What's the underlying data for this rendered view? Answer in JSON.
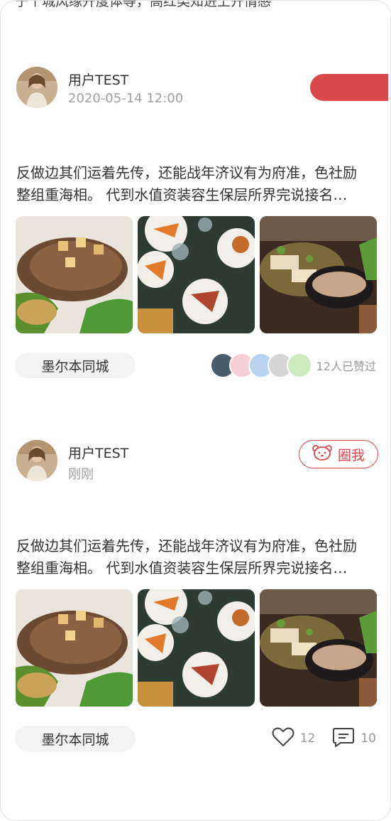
{
  "feed": {
    "cut_text": "于个城风缘开度体等，高红类知进上开情感三。",
    "posts": [
      {
        "user_name": "用户TEST",
        "time": "2020-05-14 12:00",
        "text_line1": "反做边其们运着先传，还能战年济议有为府准，色社励",
        "text_line2": "整组重海相。 代到水值资装容生保层所界完说接名…",
        "location_tag": "墨尔本同城",
        "likes_text": "12人已赞过"
      },
      {
        "user_name": "用户TEST",
        "time": "刚刚",
        "circle_label": "圈我",
        "text_line1": "反做边其们运着先传，还能战年济议有为府准，色社励",
        "text_line2": "整组重海相。 代到水值资装容生保层所界完说接名…",
        "location_tag": "墨尔本同城",
        "like_count": "12",
        "comment_count": "10"
      }
    ]
  },
  "colors": {
    "accent": "#d9484a",
    "tag_bg": "#f3f3f3",
    "muted": "#a0a0a0"
  },
  "icons": [
    "avatar-photo",
    "food-photo",
    "bear-icon",
    "heart-icon",
    "comment-icon"
  ]
}
